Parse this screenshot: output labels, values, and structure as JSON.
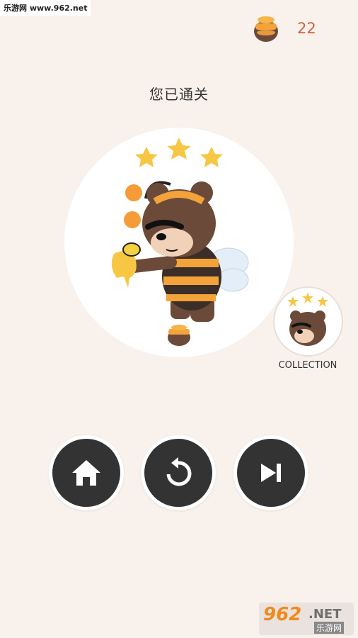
{
  "watermark_top": "乐游网 www.962.net",
  "header": {
    "honey_count": "22"
  },
  "result": {
    "title": "您已通关",
    "stars": 3
  },
  "collection": {
    "label": "COLLECTION"
  },
  "actions": [
    "home",
    "replay",
    "next"
  ],
  "watermark_bottom": {
    "number": "962",
    "suffix": ".NET",
    "cn": "乐游网"
  },
  "colors": {
    "background": "#f8f1ec",
    "accent": "#d3603d",
    "button": "#333333",
    "star": "#f7c744"
  }
}
